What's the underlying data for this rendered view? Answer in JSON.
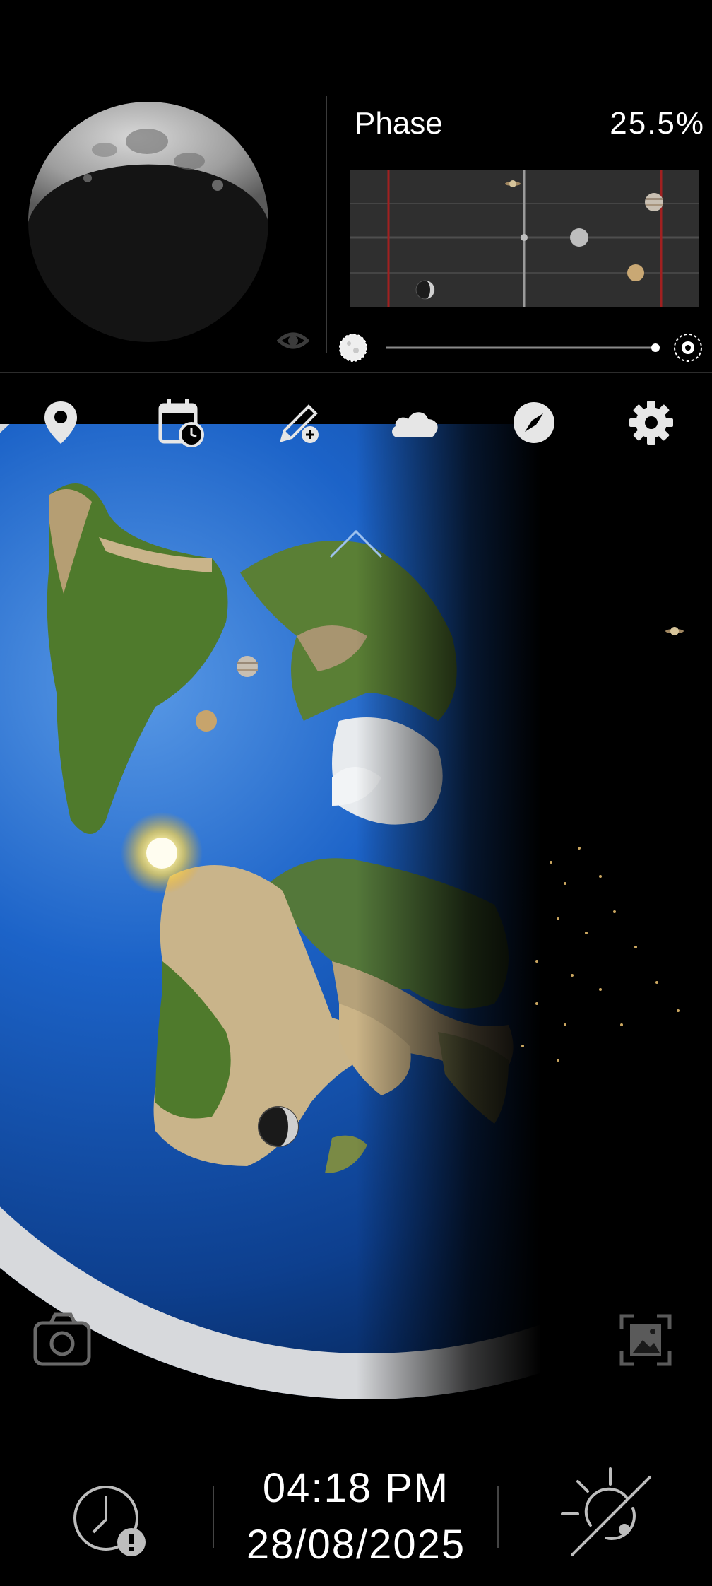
{
  "moon_panel": {
    "phase_label": "Phase",
    "phase_value": "25.5%",
    "illumination_fraction": 0.255
  },
  "planet_strip": {
    "bodies": [
      "saturn-icon",
      "jupiter-icon",
      "mercury-icon",
      "venus-icon",
      "moon-icon",
      "center-marker"
    ]
  },
  "slider": {
    "position_fraction": 1.0,
    "left_icon": "full-moon-icon",
    "right_icon": "target-icon"
  },
  "toolbar": {
    "items": [
      {
        "name": "location",
        "icon": "location-pin-icon"
      },
      {
        "name": "calendar",
        "icon": "calendar-clock-icon"
      },
      {
        "name": "edit",
        "icon": "pencil-add-icon"
      },
      {
        "name": "weather",
        "icon": "cloud-icon"
      },
      {
        "name": "compass",
        "icon": "compass-icon"
      },
      {
        "name": "settings",
        "icon": "gear-icon"
      }
    ]
  },
  "bottom_bar": {
    "time": "04:18 PM",
    "date": "28/08/2025",
    "left_icon": "clock-alert-icon",
    "right_icon": "sun-off-icon"
  },
  "colors": {
    "background": "#000000",
    "ocean": "#1656b8",
    "land_green": "#4f7a2c",
    "land_desert": "#c9b48a",
    "ice": "#e6e8ea",
    "strip_bg": "#2f2f2f",
    "strip_red_line": "#b22222"
  }
}
